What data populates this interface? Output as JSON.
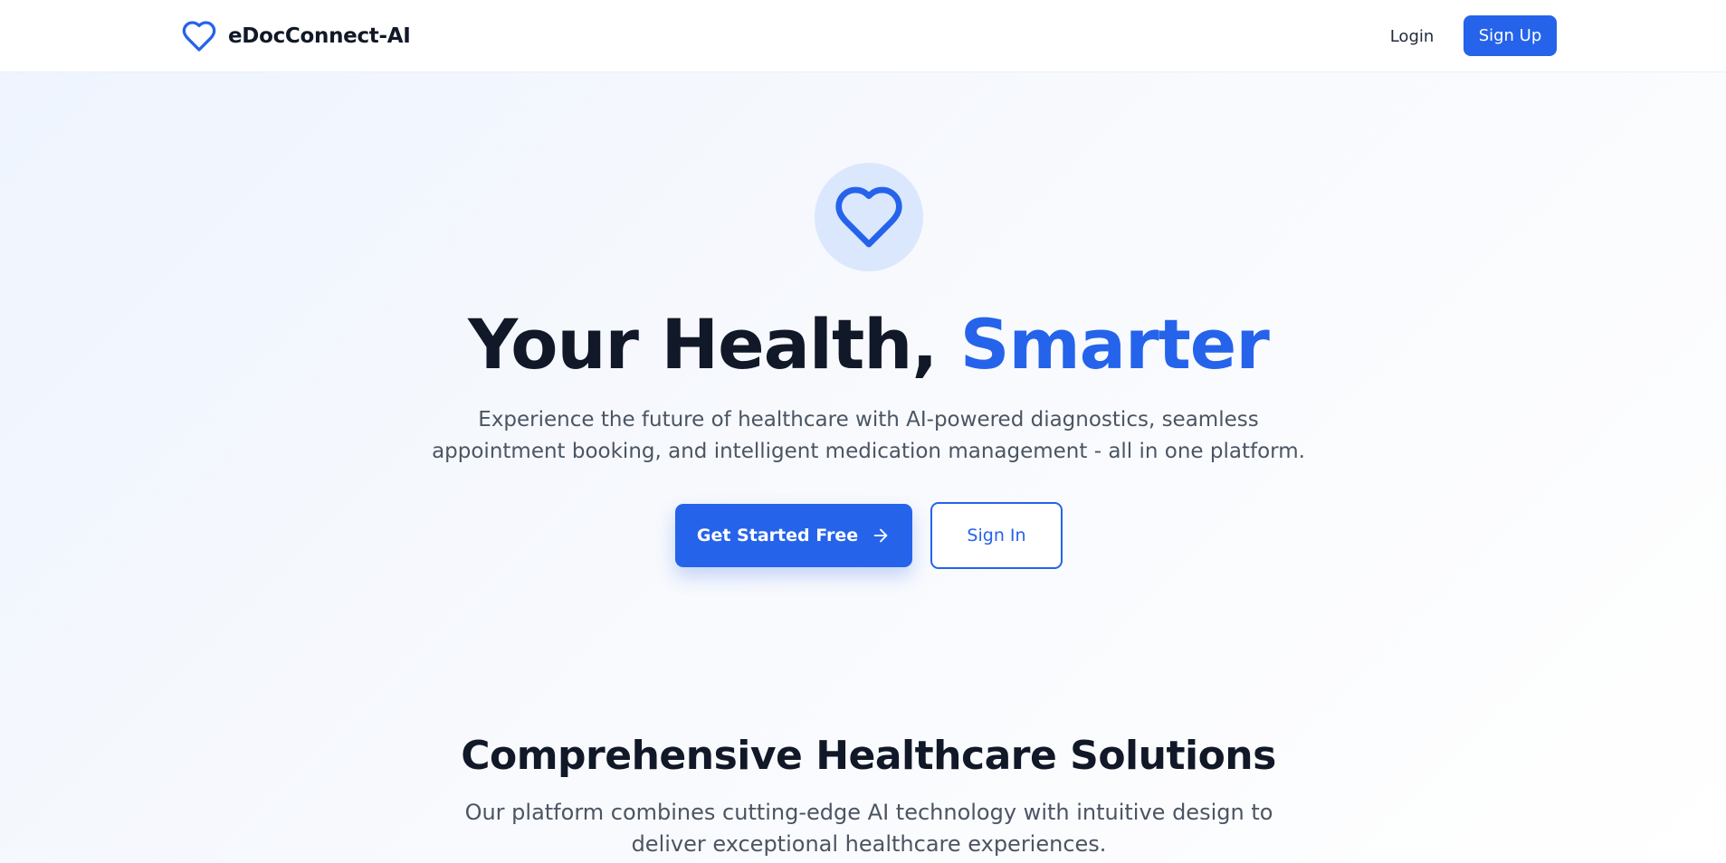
{
  "header": {
    "brand_name": "eDocConnect-AI",
    "brand_icon": "heart-icon",
    "login_label": "Login",
    "signup_label": "Sign Up"
  },
  "hero": {
    "icon": "heart-icon",
    "title_main": "Your Health, ",
    "title_accent": "Smarter",
    "subtitle": "Experience the future of healthcare with AI-powered diagnostics, seamless appointment booking, and intelligent medication management - all in one platform.",
    "primary_cta_label": "Get Started Free",
    "primary_cta_icon": "arrow-right-icon",
    "secondary_cta_label": "Sign In"
  },
  "features": {
    "title": "Comprehensive Healthcare Solutions",
    "subtitle": "Our platform combines cutting-edge AI technology with intuitive design to deliver exceptional healthcare experiences."
  },
  "colors": {
    "accent": "#2563eb",
    "heading": "#111827",
    "body_text": "#4b5563",
    "icon_badge_bg": "#dbe7fd"
  }
}
